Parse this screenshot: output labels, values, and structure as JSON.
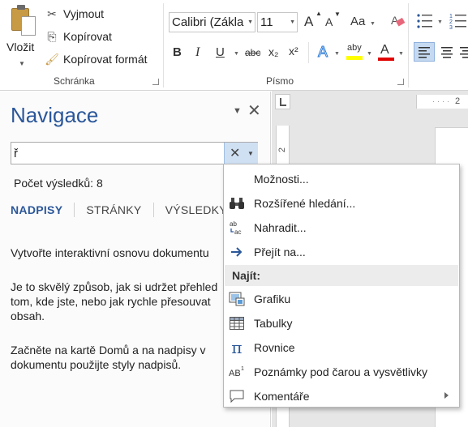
{
  "ribbon": {
    "clipboard": {
      "paste_label": "Vložit",
      "cut_label": "Vyjmout",
      "copy_label": "Kopírovat",
      "format_painter_label": "Kopírovat formát",
      "group_label": "Schránka"
    },
    "font": {
      "font_name": "Calibri (Zákla",
      "font_size": "11",
      "group_label": "Písmo",
      "grow_font": "A",
      "shrink_font": "A",
      "change_case": "Aa",
      "bold": "B",
      "italic": "I",
      "underline": "U",
      "strikethrough": "abc",
      "subscript": "x₂",
      "superscript": "x²",
      "text_effects": "A",
      "highlight": "aby",
      "font_color": "A"
    }
  },
  "ruler": {
    "h_number": "2",
    "v_number": "2"
  },
  "navigation": {
    "title": "Navigace",
    "search_value": "ř",
    "result_count": "Počet výsledků: 8",
    "tabs": [
      {
        "label": "NADPISY",
        "active": true
      },
      {
        "label": "STRÁNKY",
        "active": false
      },
      {
        "label": "VÝSLEDKY",
        "active": false
      }
    ],
    "info": {
      "p1": "Vytvořte interaktivní osnovu dokumentu",
      "p2_l1": "Je to skvělý způsob, jak si udržet přehled",
      "p2_l2": "tom, kde jste, nebo jak rychle přesouvat",
      "p2_l3": "obsah.",
      "p3_l1": "Začněte na kartě Domů a na nadpisy v",
      "p3_l2": "dokumentu použijte styly nadpisů."
    }
  },
  "menu": {
    "options": "Možnosti...",
    "advanced_find": "Rozšířené hledání...",
    "replace": "Nahradit...",
    "goto": "Přejít na...",
    "find_header": "Najít:",
    "graphics": "Grafiku",
    "tables": "Tabulky",
    "equations": "Rovnice",
    "footnotes": "Poznámky pod čarou a vysvětlivky",
    "comments": "Komentáře"
  },
  "colors": {
    "accent": "#2b579a",
    "highlight_yellow": "#ffff00",
    "font_red": "#e00000",
    "search_action_bg": "#cfe0f3"
  }
}
